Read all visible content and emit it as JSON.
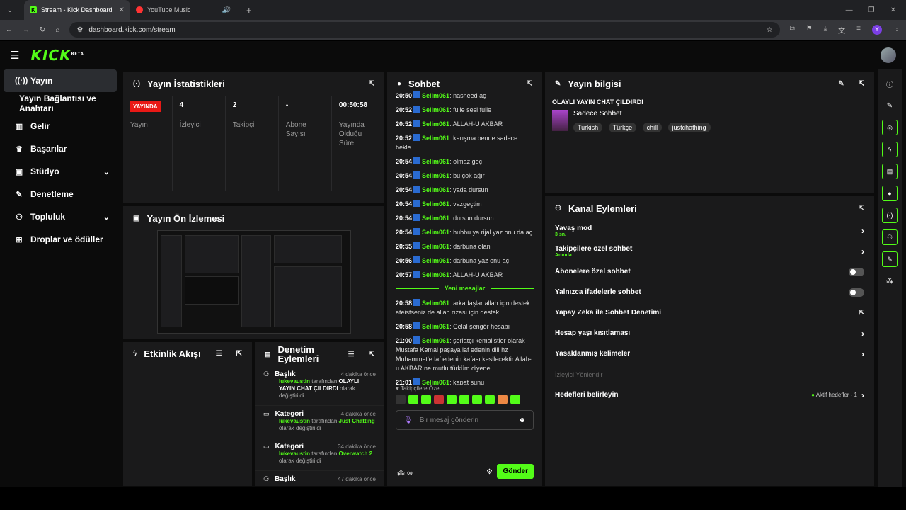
{
  "browser": {
    "tabs": [
      {
        "title": "Stream - Kick Dashboard"
      },
      {
        "title": "YouTube Music"
      }
    ],
    "url": "dashboard.kick.com/stream",
    "profile_initial": "Y"
  },
  "nav": {
    "logo": "KICK",
    "logo_badge": "BETA"
  },
  "sidebar": {
    "items": [
      {
        "label": "Yayın"
      },
      {
        "label": "Yayın Bağlantısı ve Anahtarı"
      },
      {
        "label": "Gelir"
      },
      {
        "label": "Başarılar"
      },
      {
        "label": "Stüdyo"
      },
      {
        "label": "Denetleme"
      },
      {
        "label": "Topluluk"
      },
      {
        "label": "Droplar ve ödüller"
      }
    ]
  },
  "stats": {
    "title": "Yayın İstatistikleri",
    "live_badge": "YAYINDA",
    "live_label": "Yayın",
    "viewers": {
      "value": "4",
      "label": "İzleyici"
    },
    "followers": {
      "value": "2",
      "label": "Takipçi"
    },
    "subs": {
      "value": "-",
      "label": "Abone Sayısı"
    },
    "uptime": {
      "value": "00:50:58",
      "label": "Yayında Olduğu Süre"
    }
  },
  "preview": {
    "title": "Yayın Ön İzlemesi"
  },
  "activity": {
    "title": "Etkinlik Akışı"
  },
  "modlog": {
    "title": "Denetim Eylemleri",
    "items": [
      {
        "type": "Başlık",
        "ago": "4 dakika önce",
        "user": "lukevaustin",
        "by": "tarafından",
        "value": "OLAYLI YAYIN CHAT ÇILDIRDI",
        "suffix": "olarak değiştirildi"
      },
      {
        "type": "Kategori",
        "ago": "4 dakika önce",
        "user": "lukevaustin",
        "by": "tarafından",
        "value": "Just Chatting",
        "suffix": "olarak değiştirildi"
      },
      {
        "type": "Kategori",
        "ago": "34 dakika önce",
        "user": "lukevaustin",
        "by": "tarafından",
        "value": "Overwatch 2",
        "suffix": "olarak değiştirildi"
      },
      {
        "type": "Başlık",
        "ago": "47 dakika önce"
      }
    ]
  },
  "chat": {
    "title": "Sohbet",
    "messages": [
      {
        "time": "20:50",
        "user": "Selim061",
        "text": "nasheed aç"
      },
      {
        "time": "20:52",
        "user": "Selim061",
        "text": "fulle sesi fulle"
      },
      {
        "time": "20:52",
        "user": "Selim061",
        "text": "ALLAH-U AKBAR"
      },
      {
        "time": "20:52",
        "user": "Selim061",
        "text": "karışma bende sadece bekle"
      },
      {
        "time": "20:54",
        "user": "Selim061",
        "text": "olmaz geç"
      },
      {
        "time": "20:54",
        "user": "Selim061",
        "text": "bu çok ağır"
      },
      {
        "time": "20:54",
        "user": "Selim061",
        "text": "yada dursun"
      },
      {
        "time": "20:54",
        "user": "Selim061",
        "text": "vazgeçtim"
      },
      {
        "time": "20:54",
        "user": "Selim061",
        "text": "dursun dursun"
      },
      {
        "time": "20:54",
        "user": "Selim061",
        "text": "hubbu ya rijal yaz onu da aç"
      },
      {
        "time": "20:55",
        "user": "Selim061",
        "text": "darbuna olan"
      },
      {
        "time": "20:56",
        "user": "Selim061",
        "text": "darbuna yaz onu aç"
      },
      {
        "time": "20:57",
        "user": "Selim061",
        "text": "ALLAH-U AKBAR"
      }
    ],
    "new_messages_label": "Yeni mesajlar",
    "new_messages": [
      {
        "time": "20:58",
        "user": "Selim061",
        "text": "arkadaşlar allah için destek ateistseniz de allah rızası için destek"
      },
      {
        "time": "20:58",
        "user": "Selim061",
        "text": "Celal şengör hesabı"
      },
      {
        "time": "21:00",
        "user": "Selim061",
        "text": "şeriatçı kemalistler olarak Mustafa Kemal paşaya laf edenin dili hz Muhammet'e laf edenin kafası kesilecektir Allah-u AKBAR ne mutlu türküm diyene"
      },
      {
        "time": "21:01",
        "user": "Selim061",
        "text": "kapat şunu"
      }
    ],
    "emote_section": "Takipçilere Özel",
    "input_placeholder": "Bir mesaj gönderin",
    "send_label": "Gönder"
  },
  "info": {
    "title": "Yayın bilgisi",
    "stream_title": "OLAYLI YAYIN CHAT ÇILDIRDI",
    "category": "Sadece Sohbet",
    "tags": [
      "Turkish",
      "Türkçe",
      "chill",
      "justchathing"
    ]
  },
  "channel_actions": {
    "title": "Kanal Eylemleri",
    "items": [
      {
        "label": "Yavaş mod",
        "sub": "3 sn."
      },
      {
        "label": "Takipçilere özel sohbet",
        "sub": "Anında"
      },
      {
        "label": "Abonelere özel sohbet"
      },
      {
        "label": "Yalnızca ifadelerle sohbet"
      },
      {
        "label": "Yapay Zeka ile Sohbet Denetimi"
      },
      {
        "label": "Hesap yaşı kısıtlaması"
      },
      {
        "label": "Yasaklanmış kelimeler"
      }
    ],
    "section_label": "İzleyici Yönlendir",
    "goals_label": "Hedefleri belirleyin",
    "goals_status": "Aktif hedefler - 1"
  },
  "colors": {
    "accent": "#53fc18",
    "live": "#e91916",
    "panel": "#1a1a1b"
  }
}
